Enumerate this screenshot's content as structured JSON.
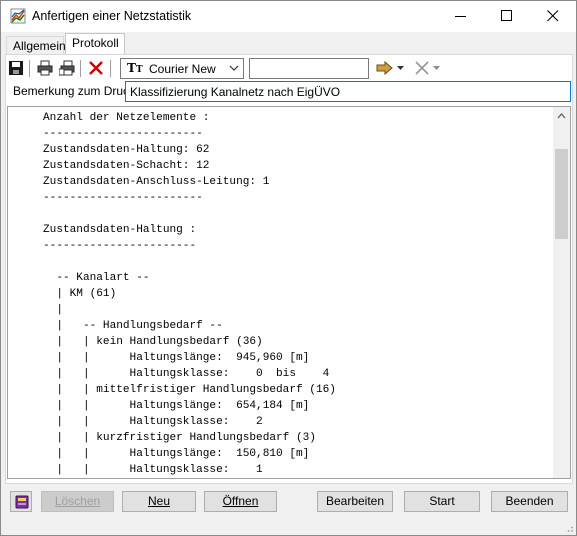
{
  "window": {
    "title": "Anfertigen einer Netzstatistik",
    "icon": "chart-app-icon"
  },
  "tabs": [
    {
      "label": "Allgemein",
      "active": false
    },
    {
      "label": "Protokoll",
      "active": true
    }
  ],
  "toolbar": {
    "icons": [
      "save-icon",
      "print-icon",
      "print-setup-icon",
      "delete-icon",
      "font-icon",
      "arrow-right-icon",
      "cancel-icon"
    ],
    "font_select": {
      "value": "Courier New"
    },
    "search_value": ""
  },
  "remark": {
    "label": "Bemerkung zum Druck",
    "value": "Klassifizierung Kanalnetz nach EigÜVO"
  },
  "protocol": {
    "text": "Anzahl der Netzelemente :\n------------------------\nZustandsdaten-Haltung: 62\nZustandsdaten-Schacht: 12\nZustandsdaten-Anschluss-Leitung: 1\n------------------------\n\nZustandsdaten-Haltung :\n-----------------------\n\n  -- Kanalart --\n  | KM (61)\n  |\n  |   -- Handlungsbedarf --\n  |   | kein Handlungsbedarf (36)\n  |   |      Haltungslänge:  945,960 [m]\n  |   |      Haltungsklasse:    0  bis    4\n  |   | mittelfristiger Handlungsbedarf (16)\n  |   |      Haltungslänge:  654,184 [m]\n  |   |      Haltungsklasse:    2\n  |   | kurzfristiger Handlungsbedarf (3)\n  |   |      Haltungslänge:  150,810 [m]\n  |   |      Haltungsklasse:    1"
  },
  "buttons": {
    "loeschen": "Löschen",
    "neu": "Neu",
    "oeffnen": "Öffnen",
    "bearbeiten": "Bearbeiten",
    "start": "Start",
    "beenden": "Beenden"
  },
  "colors": {
    "accent": "#0078d7",
    "delete_red": "#d40000",
    "arrow_brown": "#8b6a1e"
  }
}
